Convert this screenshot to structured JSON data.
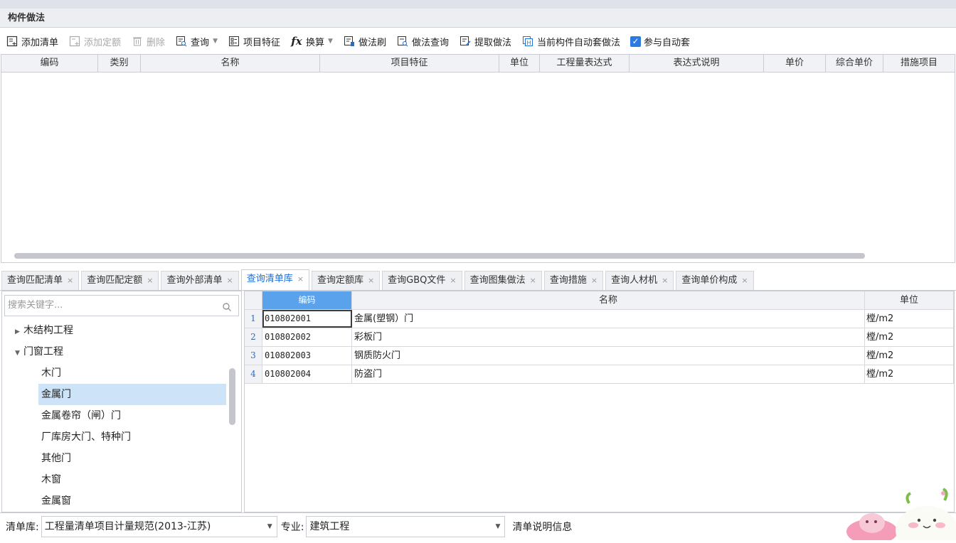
{
  "panel": {
    "title": "构件做法"
  },
  "toolbar": {
    "add_list": "添加清单",
    "add_quota": "添加定额",
    "delete": "删除",
    "query": "查询",
    "item_features": "项目特征",
    "convert": "换算",
    "method_brush": "做法刷",
    "method_query": "做法查询",
    "extract_method": "提取做法",
    "auto_apply_current": "当前构件自动套做法",
    "participate_auto": "参与自动套"
  },
  "upper_grid": {
    "columns": [
      "编码",
      "类别",
      "名称",
      "项目特征",
      "单位",
      "工程量表达式",
      "表达式说明",
      "单价",
      "综合单价",
      "措施项目"
    ]
  },
  "tabs": [
    {
      "label": "查询匹配清单"
    },
    {
      "label": "查询匹配定额"
    },
    {
      "label": "查询外部清单"
    },
    {
      "label": "查询清单库"
    },
    {
      "label": "查询定额库"
    },
    {
      "label": "查询GBQ文件"
    },
    {
      "label": "查询图集做法"
    },
    {
      "label": "查询措施"
    },
    {
      "label": "查询人材机"
    },
    {
      "label": "查询单价构成"
    }
  ],
  "tab_close": "×",
  "search": {
    "placeholder": "搜索关键字..."
  },
  "tree": [
    {
      "label": "木结构工程"
    },
    {
      "label": "门窗工程"
    },
    {
      "label": "木门"
    },
    {
      "label": "金属门"
    },
    {
      "label": "金属卷帘（闸）门"
    },
    {
      "label": "厂库房大门、特种门"
    },
    {
      "label": "其他门"
    },
    {
      "label": "木窗"
    },
    {
      "label": "金属窗"
    }
  ],
  "result_grid": {
    "columns": {
      "code": "编码",
      "name": "名称",
      "unit": "单位"
    },
    "rows": [
      {
        "num": "1",
        "code": "010802001",
        "name": "金属(塑钢）门",
        "unit": "樘/m2"
      },
      {
        "num": "2",
        "code": "010802002",
        "name": "彩板门",
        "unit": "樘/m2"
      },
      {
        "num": "3",
        "code": "010802003",
        "name": "钢质防火门",
        "unit": "樘/m2"
      },
      {
        "num": "4",
        "code": "010802004",
        "name": "防盗门",
        "unit": "樘/m2"
      }
    ]
  },
  "bottom": {
    "library_label": "清单库:",
    "library_value": "工程量清单项目计量规范(2013-江苏)",
    "specialty_label": "专业:",
    "specialty_value": "建筑工程",
    "info_label": "清单说明信息"
  },
  "colors": {
    "accent": "#1c6fd6",
    "header_highlight": "#5aa2ec",
    "selection": "#cde3f8"
  }
}
